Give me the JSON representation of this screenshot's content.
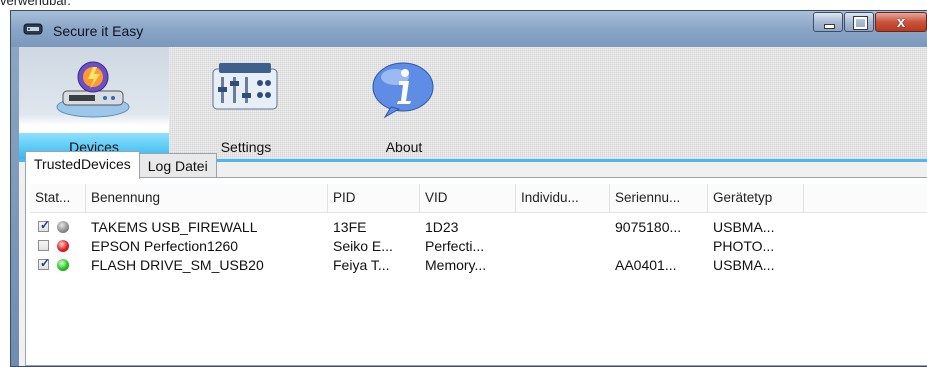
{
  "caption_fragment": "verwendbar.",
  "window": {
    "title": "Secure it Easy",
    "close_glyph": "x"
  },
  "toolbar": {
    "buttons": [
      {
        "label": "Devices",
        "icon": "devices-icon",
        "active": true
      },
      {
        "label": "Settings",
        "icon": "settings-icon",
        "active": false
      },
      {
        "label": "About",
        "icon": "about-icon",
        "active": false
      }
    ]
  },
  "tabs": [
    {
      "label": "TrustedDevices",
      "active": true
    },
    {
      "label": "Log Datei",
      "active": false
    }
  ],
  "table": {
    "columns": [
      "Stat...",
      "Benennung",
      "PID",
      "VID",
      "Individu...",
      "Seriennu...",
      "Gerätetyp"
    ],
    "rows": [
      {
        "checked": true,
        "status_color": "#8a8a8a",
        "name": "TAKEMS USB_FIREWALL",
        "pid": "13FE",
        "vid": "1D23",
        "individual": "",
        "serial": "9075180...",
        "type": "USBMA..."
      },
      {
        "checked": false,
        "status_color": "#e02020",
        "name": "EPSON Perfection1260",
        "pid": "Seiko E...",
        "vid": "Perfecti...",
        "individual": "",
        "serial": "",
        "type": "PHOTO..."
      },
      {
        "checked": true,
        "status_color": "#22c522",
        "name": "FLASH DRIVE_SM_USB20",
        "pid": "Feiya T...",
        "vid": "Memory...",
        "individual": "",
        "serial": "AA0401...",
        "type": "USBMA..."
      }
    ]
  },
  "check_glyph": "✓"
}
